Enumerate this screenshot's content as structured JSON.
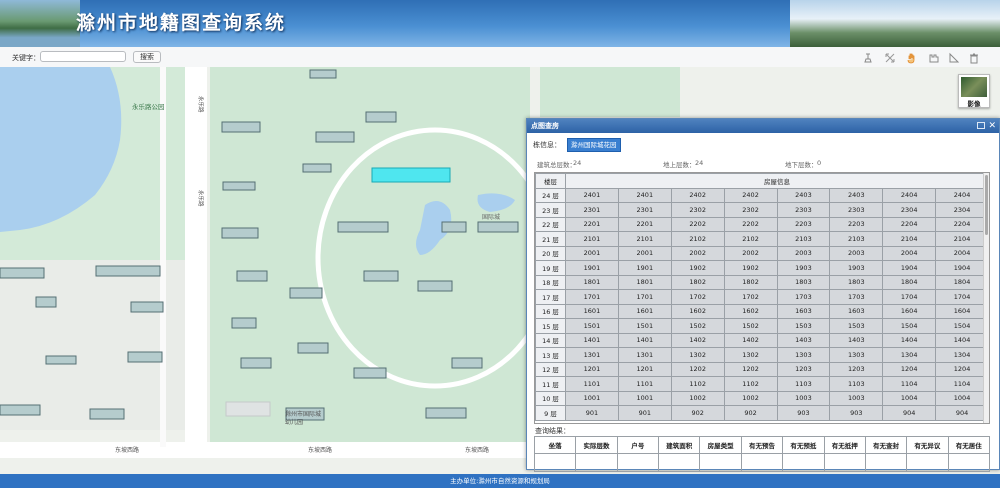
{
  "header": {
    "title": "滁州市地籍图查询系统"
  },
  "search": {
    "label": "关键字：",
    "value": "",
    "placeholder": "",
    "button": "搜索"
  },
  "toolbar": {
    "icons": [
      "measure-icon",
      "fullscreen-icon",
      "pan-hand-icon",
      "ruler-icon",
      "area-icon",
      "clear-trash-icon"
    ]
  },
  "imagery_toggle": {
    "label": "影像"
  },
  "map": {
    "labels": {
      "park": "永乐路公园",
      "road1": "永乐路",
      "road2": "东坡西路",
      "road3": "东坡西路",
      "road4": "东坡西路",
      "road5": "永乐路",
      "road6": "国际城",
      "kindergarten": "滁州市国际城",
      "kindergarten2": "幼儿园"
    }
  },
  "dialog": {
    "title": "点图查房",
    "building_label": "栋信息：",
    "building_name": "滁州国际城花园",
    "stats": {
      "total_label": "建筑总层数：",
      "total": "24",
      "above_label": "地上层数：",
      "above": "24",
      "below_label": "地下层数：",
      "below": "0"
    },
    "floor_header": "楼层",
    "room_header": "房屋信息",
    "floors": [
      {
        "floor": "24 层",
        "rooms": [
          "2401",
          "2401",
          "2402",
          "2402",
          "2403",
          "2403",
          "2404",
          "2404"
        ]
      },
      {
        "floor": "23 层",
        "rooms": [
          "2301",
          "2301",
          "2302",
          "2302",
          "2303",
          "2303",
          "2304",
          "2304"
        ]
      },
      {
        "floor": "22 层",
        "rooms": [
          "2201",
          "2201",
          "2202",
          "2202",
          "2203",
          "2203",
          "2204",
          "2204"
        ]
      },
      {
        "floor": "21 层",
        "rooms": [
          "2101",
          "2101",
          "2102",
          "2102",
          "2103",
          "2103",
          "2104",
          "2104"
        ]
      },
      {
        "floor": "20 层",
        "rooms": [
          "2001",
          "2001",
          "2002",
          "2002",
          "2003",
          "2003",
          "2004",
          "2004"
        ]
      },
      {
        "floor": "19 层",
        "rooms": [
          "1901",
          "1901",
          "1902",
          "1902",
          "1903",
          "1903",
          "1904",
          "1904"
        ]
      },
      {
        "floor": "18 层",
        "rooms": [
          "1801",
          "1801",
          "1802",
          "1802",
          "1803",
          "1803",
          "1804",
          "1804"
        ]
      },
      {
        "floor": "17 层",
        "rooms": [
          "1701",
          "1701",
          "1702",
          "1702",
          "1703",
          "1703",
          "1704",
          "1704"
        ]
      },
      {
        "floor": "16 层",
        "rooms": [
          "1601",
          "1601",
          "1602",
          "1602",
          "1603",
          "1603",
          "1604",
          "1604"
        ]
      },
      {
        "floor": "15 层",
        "rooms": [
          "1501",
          "1501",
          "1502",
          "1502",
          "1503",
          "1503",
          "1504",
          "1504"
        ]
      },
      {
        "floor": "14 层",
        "rooms": [
          "1401",
          "1401",
          "1402",
          "1402",
          "1403",
          "1403",
          "1404",
          "1404"
        ]
      },
      {
        "floor": "13 层",
        "rooms": [
          "1301",
          "1301",
          "1302",
          "1302",
          "1303",
          "1303",
          "1304",
          "1304"
        ]
      },
      {
        "floor": "12 层",
        "rooms": [
          "1201",
          "1201",
          "1202",
          "1202",
          "1203",
          "1203",
          "1204",
          "1204"
        ]
      },
      {
        "floor": "11 层",
        "rooms": [
          "1101",
          "1101",
          "1102",
          "1102",
          "1103",
          "1103",
          "1104",
          "1104"
        ]
      },
      {
        "floor": "10 层",
        "rooms": [
          "1001",
          "1001",
          "1002",
          "1002",
          "1003",
          "1003",
          "1004",
          "1004"
        ]
      },
      {
        "floor": "9 层",
        "rooms": [
          "901",
          "901",
          "902",
          "902",
          "903",
          "903",
          "904",
          "904"
        ]
      }
    ],
    "result_label": "查询结果：",
    "result_columns": [
      "坐落",
      "实际层数",
      "户号",
      "建筑面积",
      "房屋类型",
      "有无预告",
      "有无预抵",
      "有无抵押",
      "有无查封",
      "有无异议",
      "有无居住"
    ]
  },
  "footer": {
    "text": "主办单位:滁州市自然资源和规划局"
  }
}
